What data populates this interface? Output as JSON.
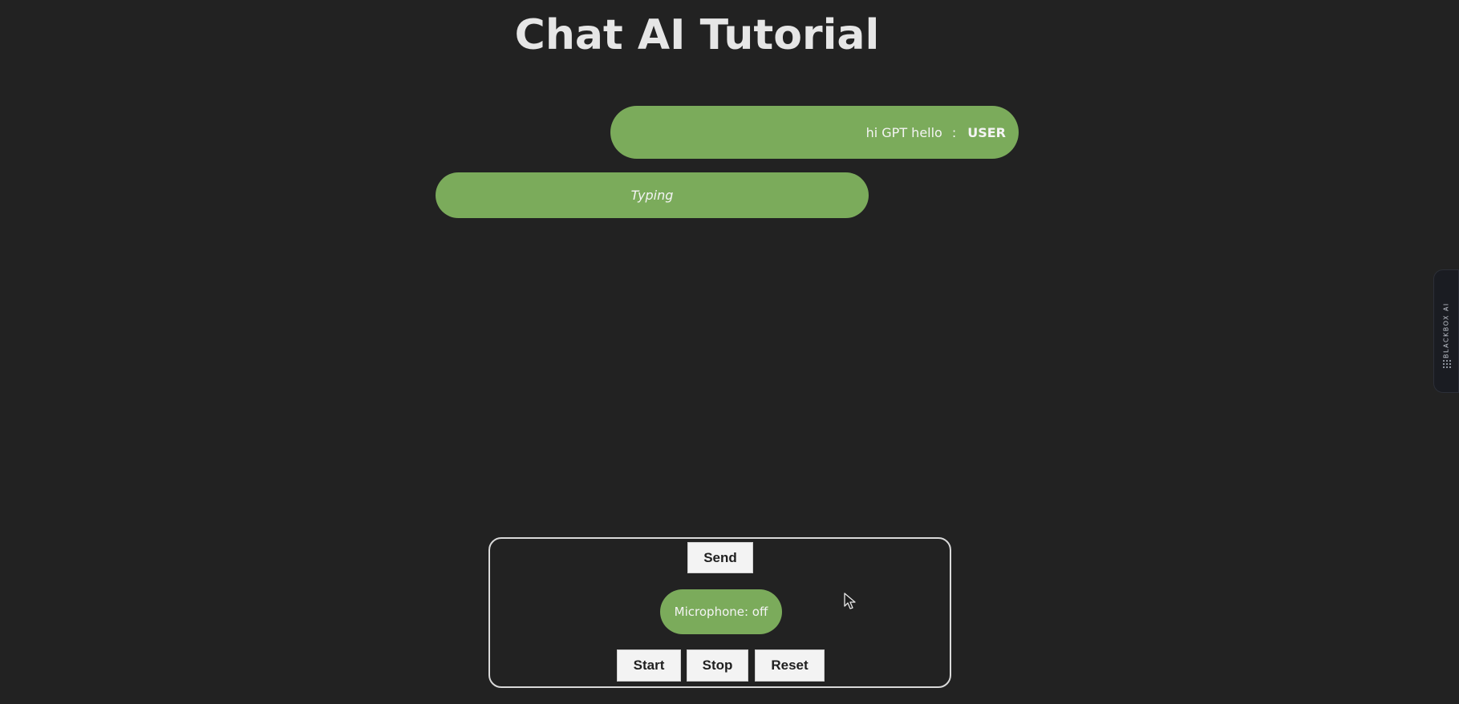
{
  "page": {
    "title": "Chat AI Tutorial"
  },
  "chat": {
    "messages": [
      {
        "role_label": "USER",
        "separator": ":",
        "text": "hi GPT hello"
      },
      {
        "text": "Typing"
      }
    ]
  },
  "controls": {
    "send_label": "Send",
    "microphone_status": "Microphone: off",
    "start_label": "Start",
    "stop_label": "Stop",
    "reset_label": "Reset"
  },
  "side_tab": {
    "label": "BLACKBOX AI"
  },
  "colors": {
    "background": "#222222",
    "accent_green": "#7bab5b",
    "title_text": "#e6e6e6",
    "button_bg": "#f3f3f3"
  },
  "icons": {
    "cursor": "mouse-pointer-icon",
    "side_tab_logo": "blackbox-logo-icon"
  }
}
